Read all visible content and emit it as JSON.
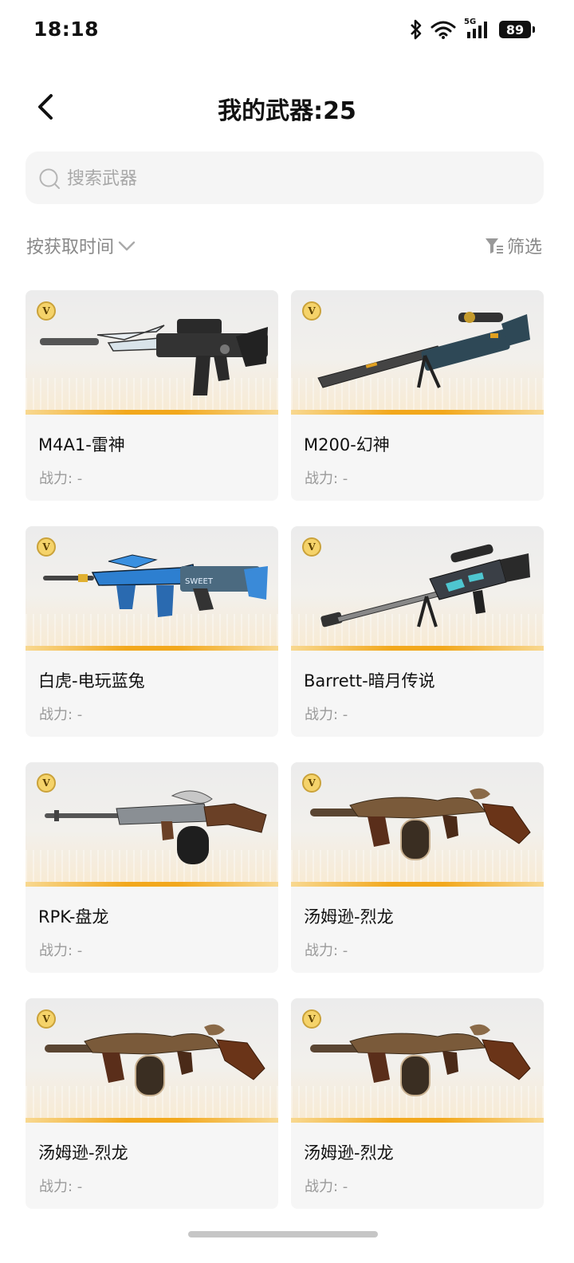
{
  "status_bar": {
    "time": "18:18",
    "battery": "89",
    "network": "5G"
  },
  "header": {
    "title": "我的武器:25"
  },
  "search": {
    "placeholder": "搜索武器"
  },
  "toolbar": {
    "sort_label": "按获取时间",
    "filter_label": "筛选"
  },
  "power_label": "战力: -",
  "badge_letter": "V",
  "colors": {
    "accent_stripe": "#f2a81c",
    "card_bg": "#f6f6f6",
    "muted_text": "#9a9a9a"
  },
  "weapons": [
    {
      "name": "M4A1-雷神",
      "icon": "assault-rifle-icon"
    },
    {
      "name": "M200-幻神",
      "icon": "sniper-rifle-icon"
    },
    {
      "name": "白虎-电玩蓝兔",
      "icon": "assault-rifle-icon"
    },
    {
      "name": "Barrett-暗月传说",
      "icon": "sniper-rifle-icon"
    },
    {
      "name": "RPK-盘龙",
      "icon": "machine-gun-icon"
    },
    {
      "name": "汤姆逊-烈龙",
      "icon": "tommy-gun-icon"
    },
    {
      "name": "汤姆逊-烈龙",
      "icon": "tommy-gun-icon"
    },
    {
      "name": "汤姆逊-烈龙",
      "icon": "tommy-gun-icon"
    }
  ]
}
